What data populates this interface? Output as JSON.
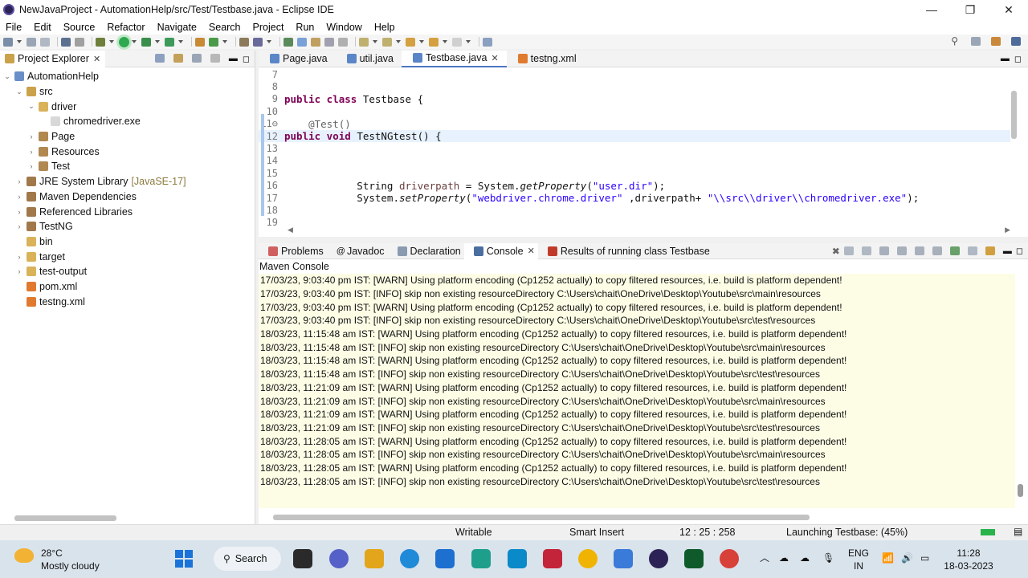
{
  "window": {
    "title": "NewJavaProject - AutomationHelp/src/Test/Testbase.java - Eclipse IDE",
    "min": "—",
    "max": "❐",
    "close": "✕"
  },
  "menu": [
    "File",
    "Edit",
    "Source",
    "Refactor",
    "Navigate",
    "Search",
    "Project",
    "Run",
    "Window",
    "Help"
  ],
  "project_explorer": {
    "tab_label": "Project Explorer",
    "close": "✕",
    "tree": [
      {
        "label": "AutomationHelp",
        "twisty": "⌄",
        "indent": 0,
        "icon": "project-icon"
      },
      {
        "label": "src",
        "twisty": "⌄",
        "indent": 1,
        "icon": "source-folder-icon"
      },
      {
        "label": "driver",
        "twisty": "⌄",
        "indent": 2,
        "icon": "folder-icon"
      },
      {
        "label": "chromedriver.exe",
        "twisty": "",
        "indent": 3,
        "icon": "file-icon"
      },
      {
        "label": "Page",
        "twisty": "›",
        "indent": 2,
        "icon": "package-icon"
      },
      {
        "label": "Resources",
        "twisty": "›",
        "indent": 2,
        "icon": "package-icon"
      },
      {
        "label": "Test",
        "twisty": "›",
        "indent": 2,
        "icon": "package-icon"
      },
      {
        "label": "JRE System Library",
        "suffix": "[JavaSE-17]",
        "twisty": "›",
        "indent": 1,
        "icon": "library-icon"
      },
      {
        "label": "Maven Dependencies",
        "twisty": "›",
        "indent": 1,
        "icon": "library-icon"
      },
      {
        "label": "Referenced Libraries",
        "twisty": "›",
        "indent": 1,
        "icon": "library-icon"
      },
      {
        "label": "TestNG",
        "twisty": "›",
        "indent": 1,
        "icon": "library-icon"
      },
      {
        "label": "bin",
        "twisty": "",
        "indent": 1,
        "icon": "folder-icon"
      },
      {
        "label": "target",
        "twisty": "›",
        "indent": 1,
        "icon": "folder-icon"
      },
      {
        "label": "test-output",
        "twisty": "›",
        "indent": 1,
        "icon": "folder-icon"
      },
      {
        "label": "pom.xml",
        "twisty": "",
        "indent": 1,
        "icon": "xml-file-icon"
      },
      {
        "label": "testng.xml",
        "twisty": "",
        "indent": 1,
        "icon": "xml-file-icon"
      }
    ]
  },
  "editor": {
    "tabs": [
      {
        "label": "Page.java",
        "active": false
      },
      {
        "label": "util.java",
        "active": false
      },
      {
        "label": "Testbase.java",
        "active": true,
        "close": "✕"
      },
      {
        "label": "testng.xml",
        "active": false
      }
    ],
    "lines": [
      {
        "n": "7",
        "text": ""
      },
      {
        "n": "8",
        "text": ""
      },
      {
        "n": "9",
        "kw": "public class",
        "rest": " Testbase {"
      },
      {
        "n": "10",
        "text": ""
      },
      {
        "n": "11⊖",
        "ann": "    @Test()"
      },
      {
        "n": "12",
        "kw": "public void",
        "rest": " TestNGtest() {",
        "current": true
      },
      {
        "n": "13",
        "text": ""
      },
      {
        "n": "14",
        "text": ""
      },
      {
        "n": "15",
        "text": ""
      },
      {
        "n": "16",
        "pre": "            String ",
        "var": "driverpath",
        "mid": " = System.",
        "method": "getProperty",
        "open": "(",
        "str": "\"user.dir\"",
        "post": ");"
      },
      {
        "n": "17",
        "pre": "            System.",
        "method": "setProperty",
        "open": "(",
        "str": "\"webdriver.chrome.driver\"",
        "mid2": " ,driverpath+ ",
        "str2": "\"\\\\src\\\\driver\\\\chromedriver.exe\"",
        "post": ");"
      },
      {
        "n": "18",
        "text": ""
      },
      {
        "n": "19",
        "text": ""
      }
    ]
  },
  "console": {
    "tabs": [
      {
        "label": "Problems",
        "active": false
      },
      {
        "label": "Javadoc",
        "active": false
      },
      {
        "label": "Declaration",
        "active": false
      },
      {
        "label": "Console",
        "active": true,
        "close": "✕"
      },
      {
        "label": "Results of running class Testbase",
        "active": false
      }
    ],
    "title": "Maven Console",
    "lines": [
      "17/03/23, 9:03:40 pm IST: [WARN] Using platform encoding (Cp1252 actually) to copy filtered resources, i.e. build is platform dependent!",
      "17/03/23, 9:03:40 pm IST: [INFO] skip non existing resourceDirectory C:\\Users\\chait\\OneDrive\\Desktop\\Youtube\\src\\main\\resources",
      "17/03/23, 9:03:40 pm IST: [WARN] Using platform encoding (Cp1252 actually) to copy filtered resources, i.e. build is platform dependent!",
      "17/03/23, 9:03:40 pm IST: [INFO] skip non existing resourceDirectory C:\\Users\\chait\\OneDrive\\Desktop\\Youtube\\src\\test\\resources",
      "18/03/23, 11:15:48 am IST: [WARN] Using platform encoding (Cp1252 actually) to copy filtered resources, i.e. build is platform dependent!",
      "18/03/23, 11:15:48 am IST: [INFO] skip non existing resourceDirectory C:\\Users\\chait\\OneDrive\\Desktop\\Youtube\\src\\main\\resources",
      "18/03/23, 11:15:48 am IST: [WARN] Using platform encoding (Cp1252 actually) to copy filtered resources, i.e. build is platform dependent!",
      "18/03/23, 11:15:48 am IST: [INFO] skip non existing resourceDirectory C:\\Users\\chait\\OneDrive\\Desktop\\Youtube\\src\\test\\resources",
      "18/03/23, 11:21:09 am IST: [WARN] Using platform encoding (Cp1252 actually) to copy filtered resources, i.e. build is platform dependent!",
      "18/03/23, 11:21:09 am IST: [INFO] skip non existing resourceDirectory C:\\Users\\chait\\OneDrive\\Desktop\\Youtube\\src\\main\\resources",
      "18/03/23, 11:21:09 am IST: [WARN] Using platform encoding (Cp1252 actually) to copy filtered resources, i.e. build is platform dependent!",
      "18/03/23, 11:21:09 am IST: [INFO] skip non existing resourceDirectory C:\\Users\\chait\\OneDrive\\Desktop\\Youtube\\src\\test\\resources",
      "18/03/23, 11:28:05 am IST: [WARN] Using platform encoding (Cp1252 actually) to copy filtered resources, i.e. build is platform dependent!",
      "18/03/23, 11:28:05 am IST: [INFO] skip non existing resourceDirectory C:\\Users\\chait\\OneDrive\\Desktop\\Youtube\\src\\main\\resources",
      "18/03/23, 11:28:05 am IST: [WARN] Using platform encoding (Cp1252 actually) to copy filtered resources, i.e. build is platform dependent!",
      "18/03/23, 11:28:05 am IST: [INFO] skip non existing resourceDirectory C:\\Users\\chait\\OneDrive\\Desktop\\Youtube\\src\\test\\resources"
    ]
  },
  "status": {
    "writable": "Writable",
    "insert": "Smart Insert",
    "position": "12 : 25 : 258",
    "launching": "Launching Testbase: (45%)",
    "progress": 0.45
  },
  "taskbar": {
    "temp": "28°C",
    "weather": "Mostly cloudy",
    "search": "Search",
    "lang1": "ENG",
    "lang2": "IN",
    "time": "11:28",
    "date": "18-03-2023"
  },
  "colors": {
    "keyword": "#7f0055",
    "string": "#2a00ff",
    "console_bg": "#fdfde6",
    "progress": "#29b34a"
  }
}
